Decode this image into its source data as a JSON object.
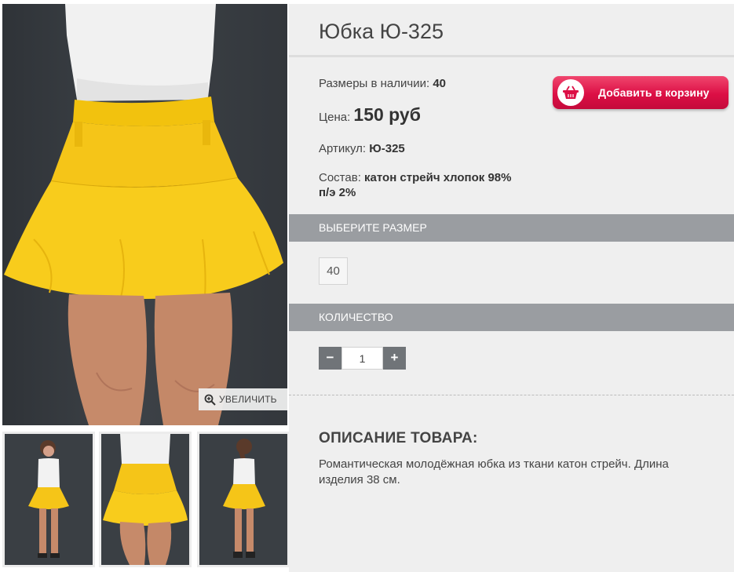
{
  "gallery": {
    "zoom_label": "УВЕЛИЧИТЬ"
  },
  "product": {
    "title": "Юбка Ю-325",
    "sizes_label": "Размеры в наличии:",
    "sizes_value": "40",
    "price_label": "Цена:",
    "price_value": "150 руб",
    "article_label": "Артикул:",
    "article_value": "Ю-325",
    "composition_label": "Состав:",
    "composition_value_line1": "катон стрейч хлопок 98%",
    "composition_value_line2": "п/э 2%"
  },
  "cart": {
    "button_label": "Добавить в корзину",
    "accent_color": "#dc0f45"
  },
  "size_section": {
    "heading": "ВЫБЕРИТЕ РАЗМЕР",
    "options": [
      "40"
    ]
  },
  "quantity_section": {
    "heading": "КОЛИЧЕСТВО",
    "minus_label": "−",
    "plus_label": "+",
    "value": "1"
  },
  "description": {
    "heading": "ОПИСАНИЕ ТОВАРА:",
    "text": "Романтическая молодёжная юбка из ткани катон стрейч. Длина изделия 38 см."
  },
  "colors": {
    "skirt": "#f5c518",
    "section_bar": "#9a9da1",
    "panel_bg": "#efefef"
  }
}
